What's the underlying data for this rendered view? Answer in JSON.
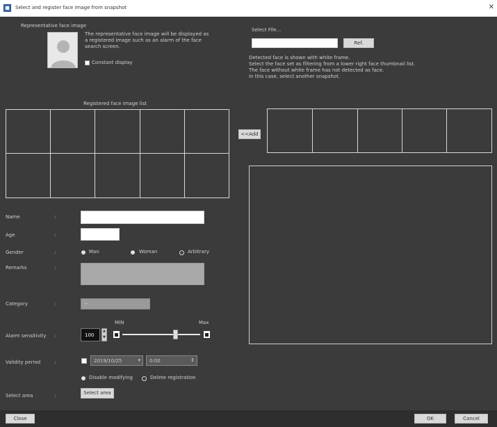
{
  "window": {
    "title": "Select and register face image from snapshot"
  },
  "representative": {
    "heading": "Representative face image",
    "description": "The representative face image will be displayed as a registered image such as an alarm of the face search screen.",
    "constant_display": "Constant display"
  },
  "registered_list": {
    "heading": "Registered face image list"
  },
  "select_file": {
    "heading": "Select File...",
    "input_value": "",
    "browse_label": "Ref.",
    "info_lines": [
      "Detected face is shown with white frame.",
      "Select the face set as filtering from a lower right face thumbnail list.",
      "The face without white frame has not detected as face.",
      "In this case, select another snapshot."
    ]
  },
  "move_button": "<<Add",
  "form": {
    "name_label": "Name",
    "age_label": "Age",
    "gender_label": "Gender",
    "gender_options": [
      "Man",
      "Woman",
      "Arbitrary"
    ],
    "remarks_label": "Remarks",
    "category_label": "Category",
    "category_value": "--",
    "alarm_label": "Alarm sensitivity",
    "alarm_value": "100",
    "slider_min": "MIN",
    "slider_max": "Max",
    "slider_fraction": 0.68,
    "validity_label": "Validity period",
    "validity_date": "2019/10/25",
    "validity_time": "0:00",
    "validity_options": [
      "Disable modifying",
      "Delete registration"
    ],
    "select_area_label": "Select area",
    "select_area_button": "Select area",
    "colon": ":"
  },
  "footer": {
    "close": "Close",
    "ok": "OK",
    "cancel": "Cancel"
  }
}
